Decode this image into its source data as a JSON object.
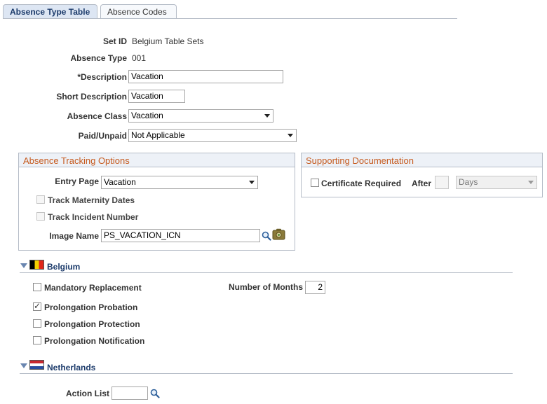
{
  "tabs": [
    {
      "label": "Absence Type Table",
      "active": true
    },
    {
      "label": "Absence Codes",
      "active": false
    }
  ],
  "header": {
    "set_id_label": "Set ID",
    "set_id_value": "Belgium Table Sets",
    "absence_type_label": "Absence Type",
    "absence_type_value": "001",
    "description_label": "*Description",
    "description_value": "Vacation",
    "short_description_label": "Short Description",
    "short_description_value": "Vacation",
    "absence_class_label": "Absence Class",
    "absence_class_value": "Vacation",
    "paid_unpaid_label": "Paid/Unpaid",
    "paid_unpaid_value": "Not Applicable"
  },
  "tracking": {
    "title": "Absence Tracking Options",
    "entry_page_label": "Entry Page",
    "entry_page_value": "Vacation",
    "track_maternity_label": "Track Maternity Dates",
    "track_maternity_checked": false,
    "track_incident_label": "Track Incident Number",
    "track_incident_checked": false,
    "image_name_label": "Image Name",
    "image_name_value": "PS_VACATION_ICN"
  },
  "supporting": {
    "title": "Supporting Documentation",
    "certificate_label": "Certificate Required",
    "certificate_checked": false,
    "after_label": "After",
    "after_value": "",
    "unit_value": "Days"
  },
  "belgium": {
    "title": "Belgium",
    "mandatory_replacement_label": "Mandatory Replacement",
    "mandatory_replacement_checked": false,
    "months_label": "Number of Months",
    "months_value": "2",
    "prolongation_probation_label": "Prolongation Probation",
    "prolongation_probation_checked": true,
    "prolongation_protection_label": "Prolongation Protection",
    "prolongation_protection_checked": false,
    "prolongation_notification_label": "Prolongation Notification",
    "prolongation_notification_checked": false
  },
  "netherlands": {
    "title": "Netherlands",
    "action_list_label": "Action List",
    "action_list_value": ""
  },
  "icons": {
    "lookup": "magnifier-icon",
    "image_preview": "picture-icon",
    "collapse": "triangle-down-icon"
  },
  "colors": {
    "section_header": "#c65a1e",
    "tab_active_bg": "#dde6f3",
    "title_blue": "#1c3b6b"
  }
}
